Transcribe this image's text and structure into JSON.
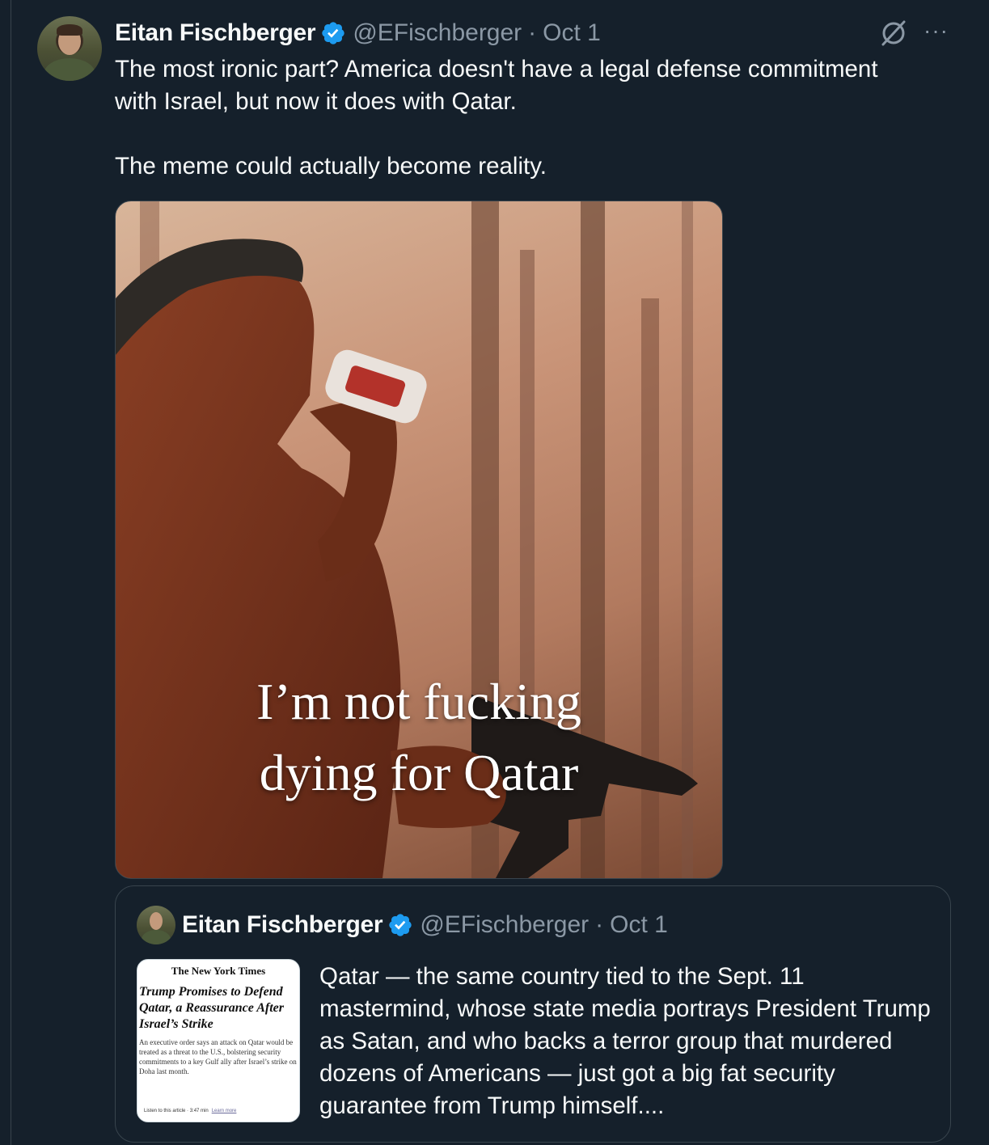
{
  "tweet": {
    "author_name": "Eitan Fischberger",
    "handle": "@EFischberger",
    "separator": "·",
    "date": "Oct 1",
    "text": "The most ironic part? America doesn't have a legal defense commitment\nwith Israel, but now it does with Qatar.\n\nThe meme could actually become reality.",
    "more_label": "···",
    "media": {
      "line1": "I’m not fucking",
      "line2": "dying for Qatar"
    }
  },
  "quoted_tweet": {
    "author_name": "Eitan Fischberger",
    "handle": "@EFischberger",
    "separator": "·",
    "date": "Oct 1",
    "text": "Qatar — the same country tied to the Sept. 11 mastermind, whose state media portrays President Trump as Satan, and who backs a terror group that murdered dozens of Americans — just got a big fat security guarantee from Trump himself....",
    "article": {
      "source": "The New York Times",
      "headline": "Trump Promises to Defend Qatar, a Reassurance After Israel’s Strike",
      "summary": "An executive order says an attack on Qatar would be treated as a threat to the U.S., bolstering security commitments to a key Gulf ally after Israel’s strike on Doha last month.",
      "listen": "Listen to this article · 3:47 min",
      "learn_more": "Learn more"
    }
  },
  "colors": {
    "background": "#15202b",
    "text_primary": "#f7f9f9",
    "text_secondary": "#8b98a5",
    "verified_blue": "#1d9bf0",
    "border": "#38444d"
  },
  "icons": [
    "verified-badge-icon",
    "grok-icon",
    "more-options-icon"
  ]
}
